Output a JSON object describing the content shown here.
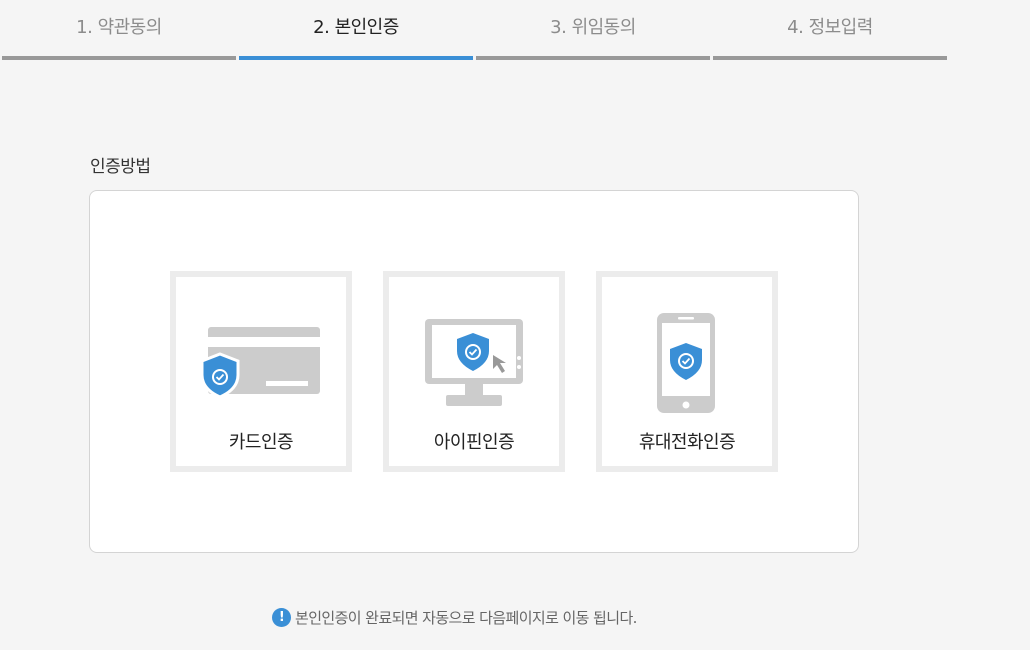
{
  "steps": [
    {
      "label": "1. 약관동의",
      "active": false
    },
    {
      "label": "2. 본인인증",
      "active": true
    },
    {
      "label": "3. 위임동의",
      "active": false
    },
    {
      "label": "4. 정보입력",
      "active": false
    }
  ],
  "section": {
    "title": "인증방법"
  },
  "methods": [
    {
      "label": "카드인증",
      "icon": "card-shield-icon"
    },
    {
      "label": "아이핀인증",
      "icon": "monitor-shield-icon"
    },
    {
      "label": "휴대전화인증",
      "icon": "phone-shield-icon"
    }
  ],
  "notice": {
    "icon": "exclamation-icon",
    "text": "본인인증이 완료되면 자동으로 다음페이지로 이동 됩니다."
  },
  "colors": {
    "accent": "#3a8fd6",
    "inactive_bar": "#999999",
    "icon_gray": "#cccccc",
    "background": "#f5f5f5"
  }
}
